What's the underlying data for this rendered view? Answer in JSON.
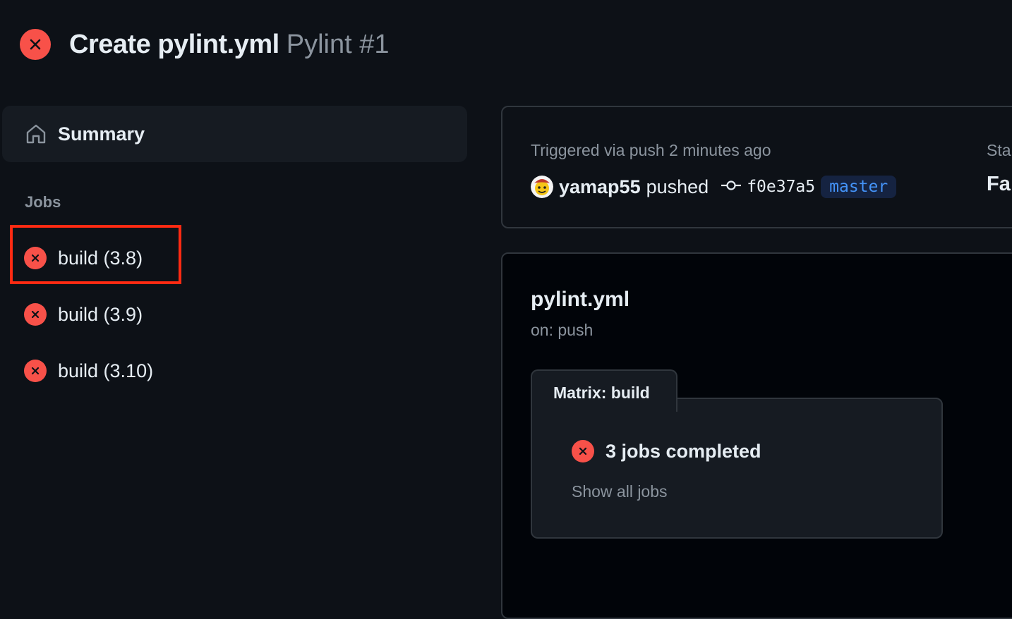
{
  "header": {
    "title": "Create pylint.yml",
    "subtitle": "Pylint #1",
    "status_icon": "x-circle-fill-icon"
  },
  "sidebar": {
    "summary_label": "Summary",
    "summary_icon": "home-icon",
    "jobs_heading": "Jobs",
    "jobs": [
      {
        "label": "build (3.8)",
        "status": "failed"
      },
      {
        "label": "build (3.9)",
        "status": "failed"
      },
      {
        "label": "build (3.10)",
        "status": "failed"
      }
    ]
  },
  "run_info": {
    "trigger": "Triggered via push 2 minutes ago",
    "username": "yamap55",
    "action": "pushed",
    "commit_sha": "f0e37a5",
    "branch": "master",
    "status_label": "Sta",
    "status_value": "Fa"
  },
  "workflow": {
    "name": "pylint.yml",
    "trigger": "on: push",
    "matrix_label": "Matrix: build",
    "jobs_completed": "3 jobs completed",
    "show_all_jobs": "Show all jobs"
  },
  "colors": {
    "background": "#0d1117",
    "error": "#f85149",
    "highlight": "#ff2a12",
    "branch_text": "#4493f8",
    "muted_text": "#8b949e"
  }
}
